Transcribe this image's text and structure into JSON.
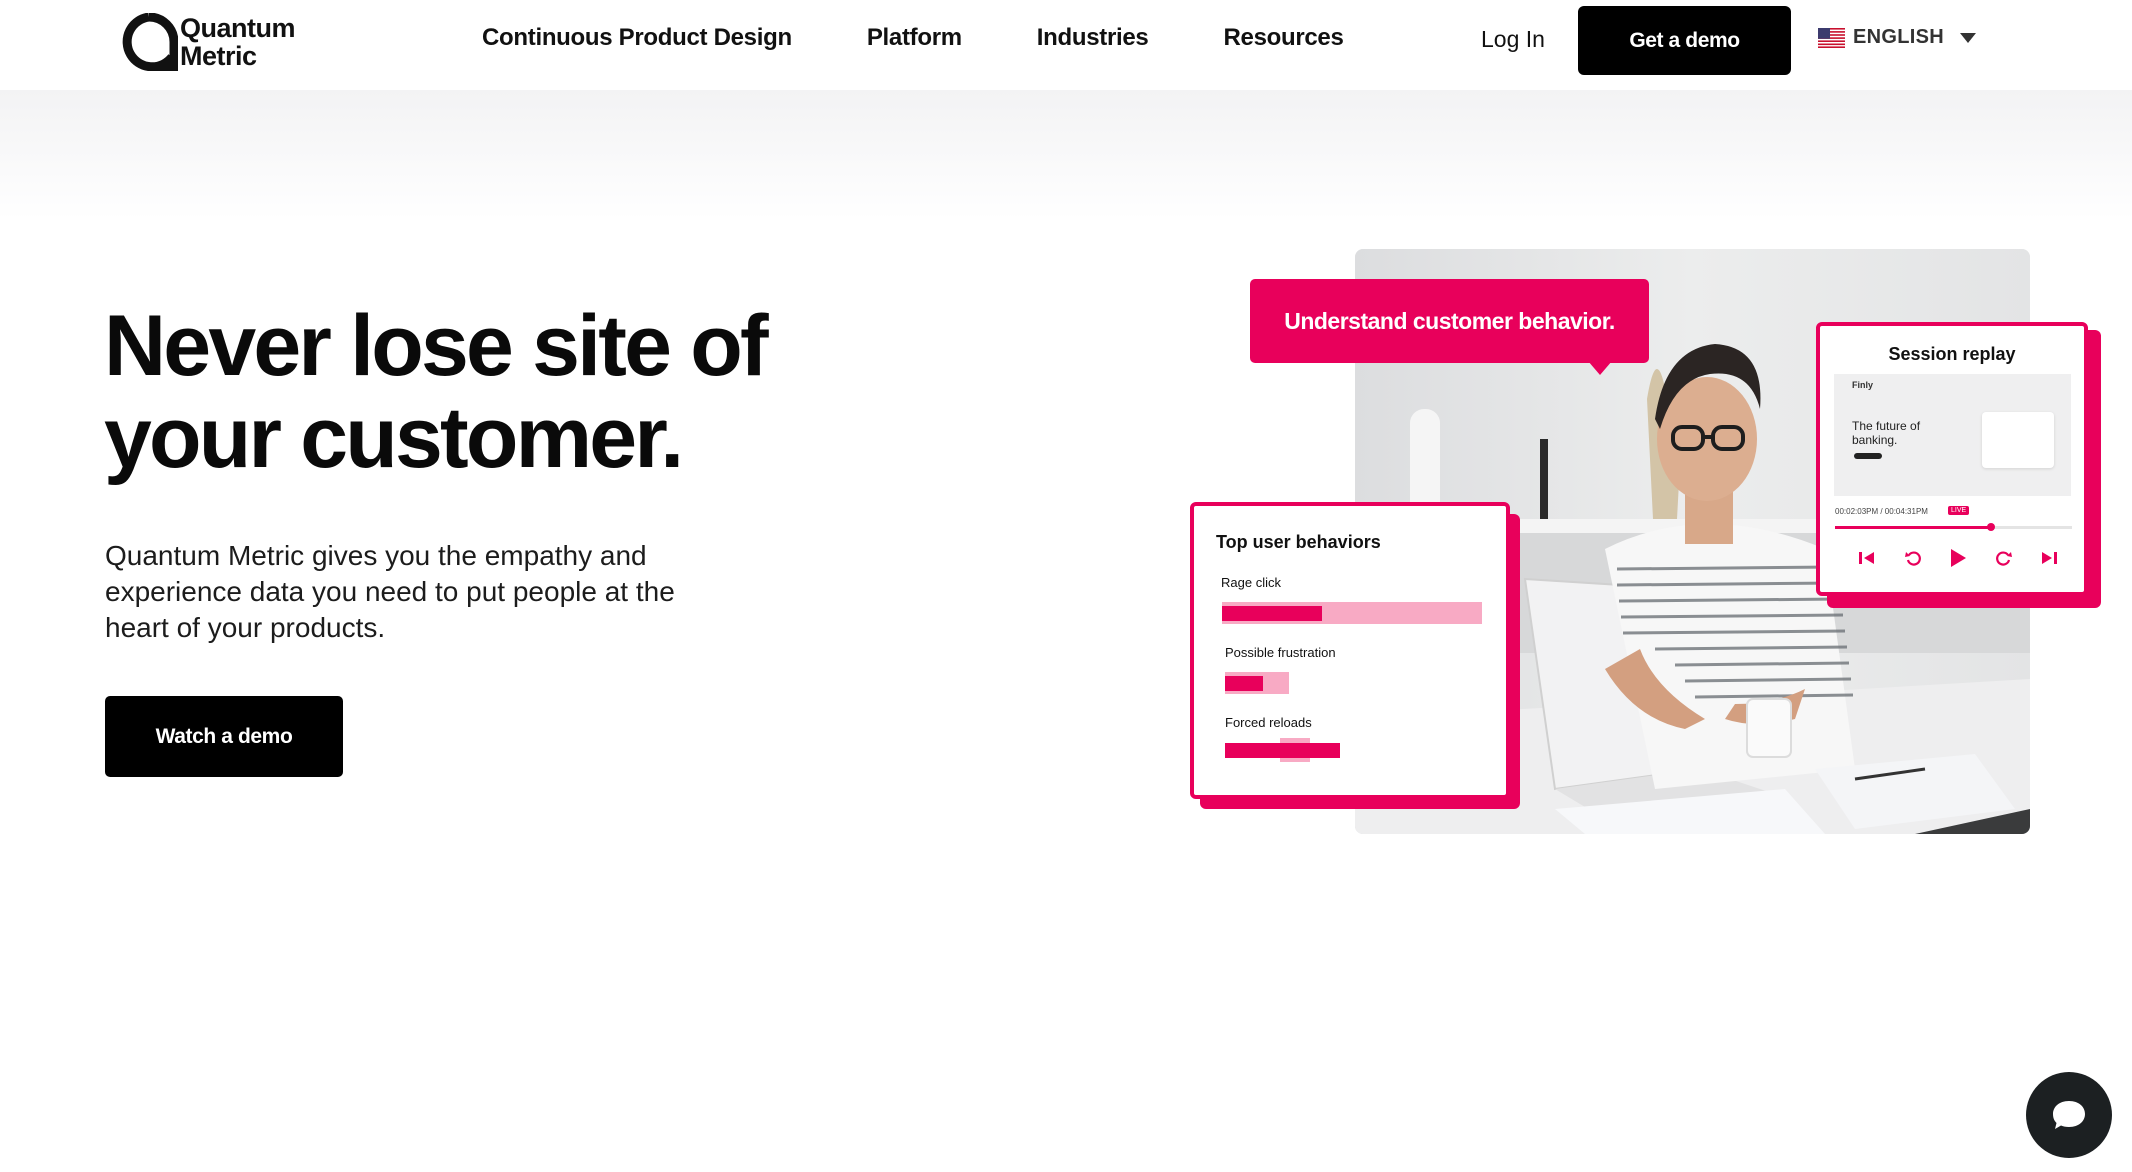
{
  "header": {
    "logo_line1": "Quantum",
    "logo_line2": "Metric",
    "nav": [
      "Continuous Product Design",
      "Platform",
      "Industries",
      "Resources"
    ],
    "login_label": "Log In",
    "cta_label": "Get a demo",
    "language": "ENGLISH",
    "flag_icon": "us-flag-icon",
    "dropdown_icon": "caret-down-icon"
  },
  "hero": {
    "title_line1": "Never lose site of",
    "title_line2": "your customer.",
    "subtitle": "Quantum Metric gives you the empathy and experience data you need to put people at the heart of your products.",
    "cta_label": "Watch a demo"
  },
  "visual": {
    "callout": "Understand customer behavior.",
    "behaviors_card": {
      "title": "Top user behaviors",
      "items": [
        {
          "label": "Rage click"
        },
        {
          "label": "Possible frustration"
        },
        {
          "label": "Forced reloads"
        }
      ]
    },
    "session_replay": {
      "title": "Session replay",
      "brand": "Finly",
      "tagline": "The future of banking.",
      "timestamp": "00:02:03PM / 00:04:31PM",
      "live_badge": "LIVE",
      "progress": 0.66,
      "controls": [
        "skip-back-icon",
        "rewind-icon",
        "play-icon",
        "forward-icon",
        "skip-forward-icon"
      ]
    }
  },
  "colors": {
    "accent": "#e8005b",
    "accent_light": "#f8aac4",
    "button_bg": "#000000",
    "chat_bg": "#1c2022"
  },
  "chat_icon": "chat-bubble-icon"
}
